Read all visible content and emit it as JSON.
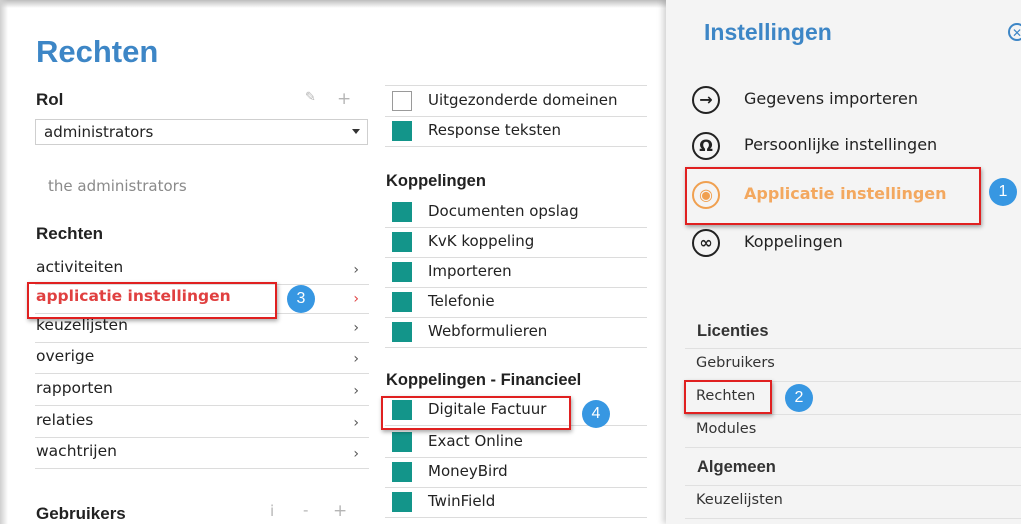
{
  "page": {
    "title": "Rechten"
  },
  "rol": {
    "label": "Rol",
    "selected": "administrators",
    "description": "the administrators"
  },
  "rechten": {
    "heading": "Rechten",
    "items": [
      {
        "label": "activiteiten"
      },
      {
        "label": "applicatie instellingen"
      },
      {
        "label": "keuzelijsten"
      },
      {
        "label": "overige"
      },
      {
        "label": "rapporten"
      },
      {
        "label": "relaties"
      },
      {
        "label": "wachtrijen"
      }
    ]
  },
  "gebruikers": {
    "heading": "Gebruikers",
    "info": "i",
    "minus": "-",
    "plus": "+"
  },
  "icons": {
    "pencil": "✎",
    "plus": "+",
    "chevron": "›"
  },
  "middle": {
    "top_items": [
      {
        "label": "Uitgezonderde domeinen",
        "checked": false
      },
      {
        "label": "Response teksten",
        "checked": true
      }
    ],
    "koppelingen": {
      "heading": "Koppelingen",
      "items": [
        {
          "label": "Documenten opslag",
          "checked": true
        },
        {
          "label": "KvK koppeling",
          "checked": true
        },
        {
          "label": "Importeren",
          "checked": true
        },
        {
          "label": "Telefonie",
          "checked": true
        },
        {
          "label": "Webformulieren",
          "checked": true
        }
      ]
    },
    "financieel": {
      "heading": "Koppelingen - Financieel",
      "items": [
        {
          "label": "Digitale Factuur",
          "checked": true
        },
        {
          "label": "Exact Online",
          "checked": true
        },
        {
          "label": "MoneyBird",
          "checked": true
        },
        {
          "label": "TwinField",
          "checked": true
        }
      ]
    }
  },
  "settings_panel": {
    "title": "Instellingen",
    "close": "✕",
    "items": [
      {
        "label": "Gegevens importeren",
        "icon": "→"
      },
      {
        "label": "Persoonlijke instellingen",
        "icon": "Ω"
      },
      {
        "label": "Applicatie instellingen",
        "icon": "◉"
      },
      {
        "label": "Koppelingen",
        "icon": "∞"
      }
    ],
    "licenties": {
      "heading": "Licenties",
      "links": [
        "Gebruikers",
        "Rechten",
        "Modules"
      ]
    },
    "algemeen": {
      "heading": "Algemeen",
      "links": [
        "Keuzelijsten"
      ]
    }
  },
  "callouts": [
    "1",
    "2",
    "3",
    "4"
  ],
  "colors": {
    "accent": "#3d86c6",
    "checkbox": "#13958a",
    "highlight": "#e02020",
    "active_orange": "#f3a85f",
    "callout": "#3797e2"
  }
}
